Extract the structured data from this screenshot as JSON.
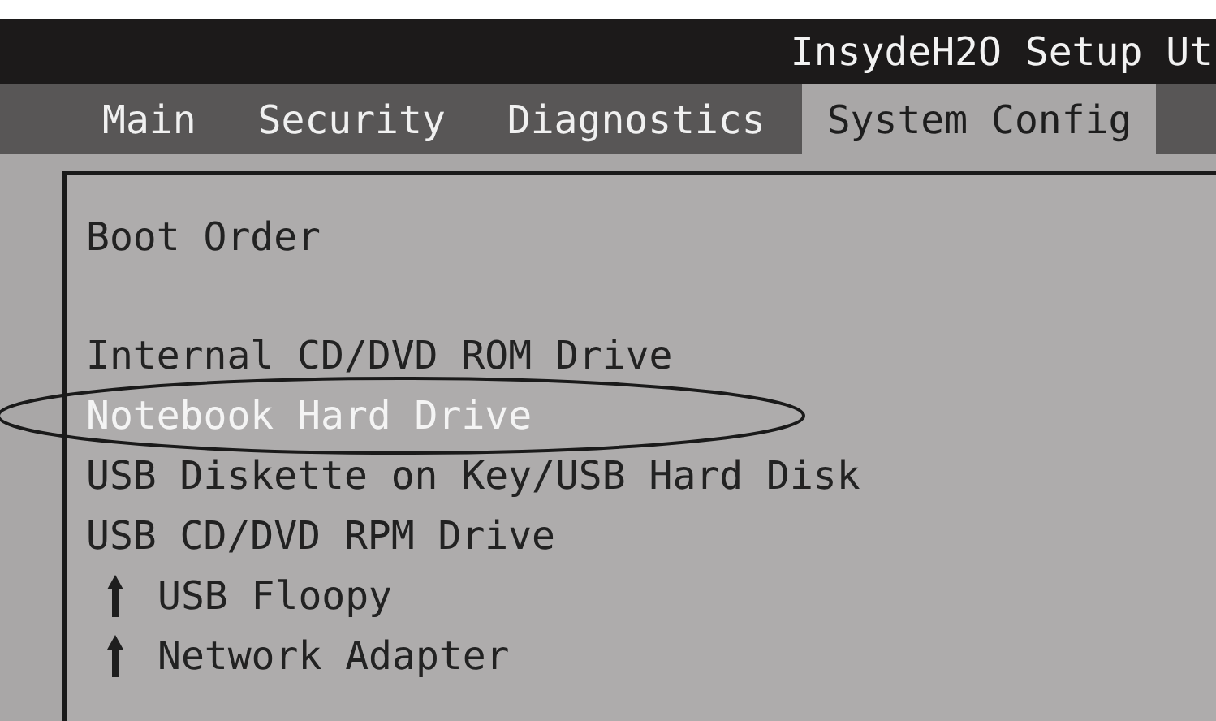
{
  "window": {
    "title": "InsydeH2O Setup Ut"
  },
  "tabs": [
    {
      "label": "Main",
      "selected": false
    },
    {
      "label": "Security",
      "selected": false
    },
    {
      "label": "Diagnostics",
      "selected": false
    },
    {
      "label": "System Config",
      "selected": true
    }
  ],
  "boot_order": {
    "heading": "Boot Order",
    "items": [
      {
        "label": "Internal CD/DVD ROM Drive",
        "kind": "plain",
        "selected": false
      },
      {
        "label": "Notebook Hard Drive",
        "kind": "plain",
        "selected": true
      },
      {
        "label": "USB Diskette on Key/USB Hard Disk",
        "kind": "plain",
        "selected": false
      },
      {
        "label": "USB CD/DVD RPM Drive",
        "kind": "plain",
        "selected": false
      },
      {
        "label": "USB Floopy",
        "kind": "marked",
        "selected": false
      },
      {
        "label": "Network Adapter",
        "kind": "marked",
        "selected": false
      }
    ]
  }
}
